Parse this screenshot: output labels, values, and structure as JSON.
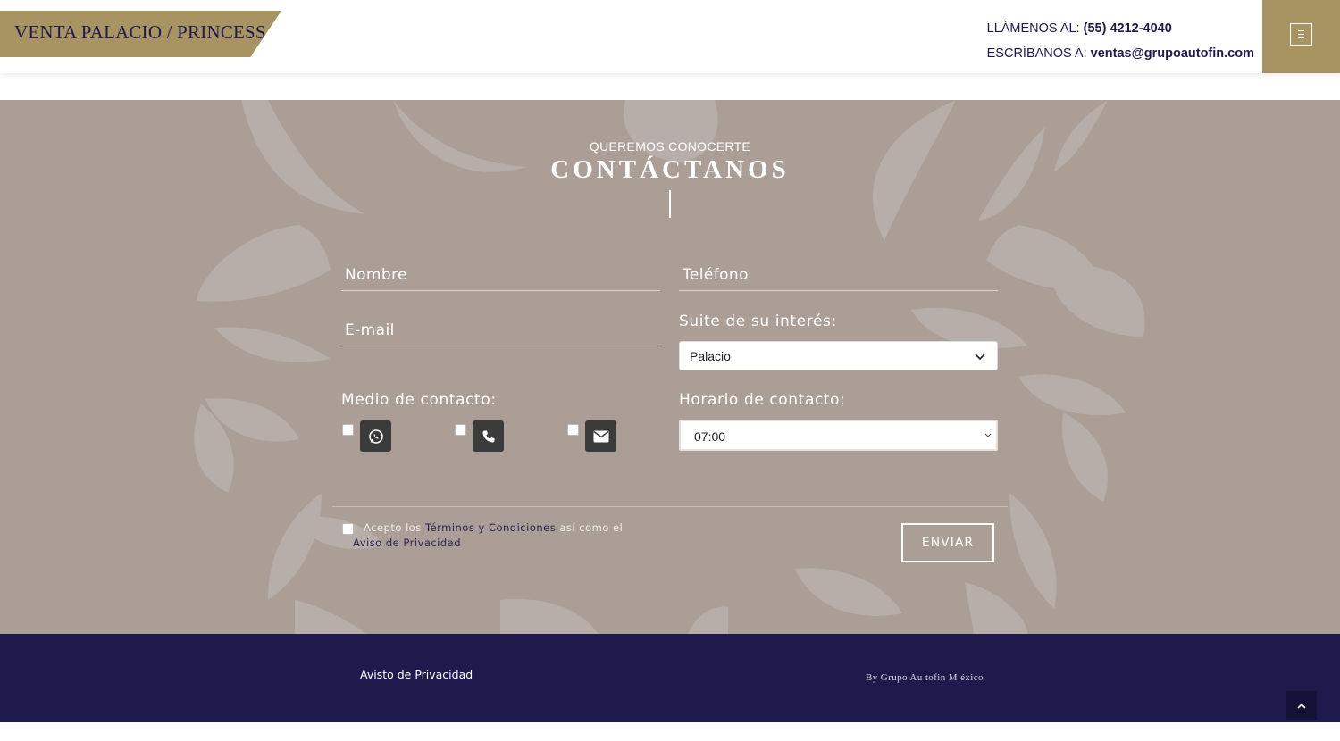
{
  "header": {
    "brand": "VENTA PALACIO / PRINCESS",
    "phone_label": "LLÁMENOS AL:",
    "phone": "(55) 4212-4040",
    "email_label": "ESCRÍBANOS A:",
    "email": "ventas@grupoautofin.com",
    "menu_icon": "menu-icon"
  },
  "contact": {
    "kicker": "QUEREMOS CONOCERTE",
    "title": "CONTÁCTANOS",
    "name_placeholder": "Nombre",
    "phone_placeholder": "Teléfono",
    "email_placeholder": "E-mail",
    "suite_label": "Suite de su interés:",
    "suite_value": "Palacio",
    "medium_label": "Medio de contacto:",
    "mediums": [
      "whatsapp-icon",
      "phone-icon",
      "envelope-icon"
    ],
    "schedule_label": "Horario de contacto:",
    "schedule_value": "07:00",
    "terms_prefix": "Acepto los",
    "terms_link": "Términos y Condiciones",
    "terms_middle": "así como el",
    "privacy_link": "Aviso de Privacidad",
    "send_label": "ENVIAR"
  },
  "footer": {
    "privacy_link": "Avisto de Privacidad",
    "credit": "By Grupo Au    tofin M éxico"
  },
  "colors": {
    "gold": "#a89463",
    "navy": "#1e1a4c",
    "section_bg": "#aa9e96"
  }
}
